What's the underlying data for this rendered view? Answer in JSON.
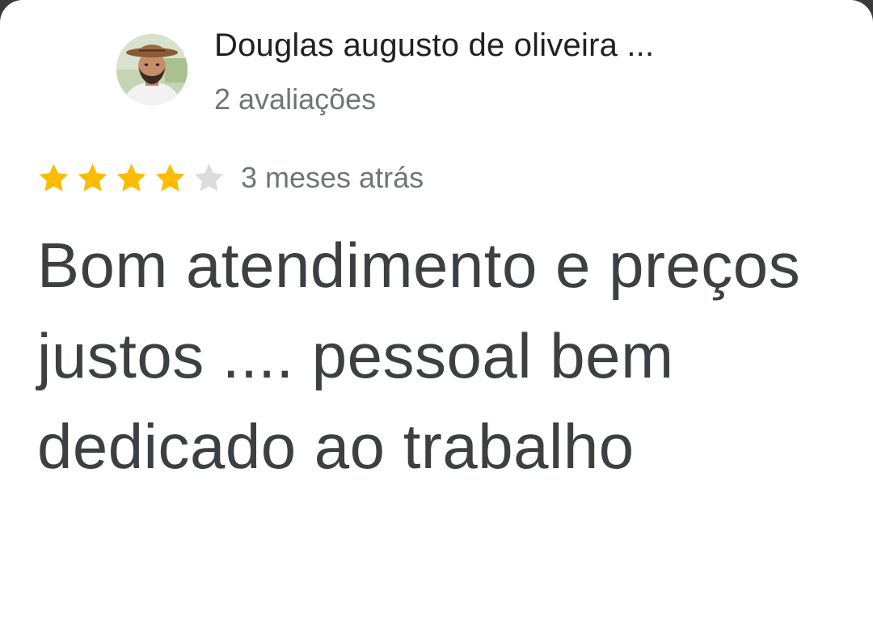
{
  "review": {
    "author_name": "Douglas augusto de oliveira ...",
    "review_count": "2 avaliações",
    "rating": 4,
    "rating_max": 5,
    "date": "3 meses atrás",
    "text": "Bom atendimento e preços justos .... pessoal bem dedicado ao trabalho"
  },
  "icons": {
    "avatar": "user-avatar-photo",
    "star_filled": "star-filled-icon",
    "star_empty": "star-empty-icon"
  },
  "colors": {
    "star_filled": "#fbbc04",
    "star_empty": "#dadce0",
    "author_name": "#202124",
    "secondary_text": "#70757a",
    "review_text": "#3c4043"
  }
}
